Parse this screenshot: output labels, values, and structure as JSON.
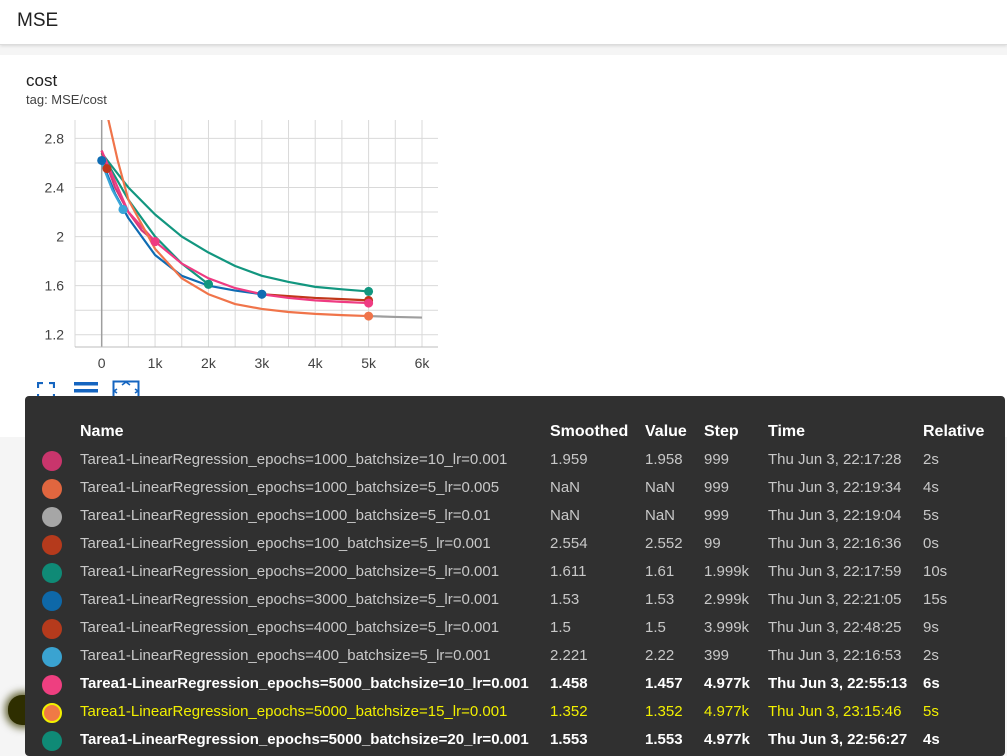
{
  "header": {
    "title": "MSE"
  },
  "card": {
    "title": "cost",
    "tag": "tag: MSE/cost"
  },
  "chart_data": {
    "type": "line",
    "title": "cost",
    "xlabel": "",
    "ylabel": "",
    "xlim": [
      -500,
      6300
    ],
    "ylim": [
      1.1,
      2.95
    ],
    "xticks": [
      0,
      1000,
      2000,
      3000,
      4000,
      5000,
      6000
    ],
    "xtick_labels": [
      "0",
      "1k",
      "2k",
      "3k",
      "4k",
      "5k",
      "6k"
    ],
    "yticks": [
      1.2,
      1.6,
      2.0,
      2.4,
      2.8
    ],
    "ytick_labels": [
      "1.2",
      "1.6",
      "2",
      "2.4",
      "2.8"
    ],
    "grid": true,
    "series": [
      {
        "name": "Tarea1-LinearRegression_epochs=1000_batchsize=5_lr=0.01",
        "color": "#9e9e9e",
        "x": [
          5000,
          5500,
          6000
        ],
        "y": [
          1.352,
          1.345,
          1.34
        ],
        "marker": false
      },
      {
        "name": "Tarea1-LinearRegression_epochs=2000_batchsize=5_lr=0.001",
        "color": "#12967f",
        "x": [
          0,
          500,
          1000,
          1500,
          2000
        ],
        "y": [
          2.68,
          2.3,
          2.0,
          1.78,
          1.611
        ],
        "marker": true
      },
      {
        "name": "Tarea1-LinearRegression_epochs=5000_batchsize=20_lr=0.001",
        "color": "#12967f",
        "x": [
          0,
          500,
          1000,
          1500,
          2000,
          2500,
          3000,
          3500,
          4000,
          4500,
          5000
        ],
        "y": [
          2.68,
          2.4,
          2.18,
          2.0,
          1.87,
          1.76,
          1.68,
          1.63,
          1.59,
          1.57,
          1.553
        ],
        "marker": true
      },
      {
        "name": "Tarea1-LinearRegression_epochs=3000_batchsize=5_lr=0.001",
        "color": "#0f6cb3",
        "x": [
          0,
          250,
          500,
          1000,
          1500,
          2000,
          2500,
          3000
        ],
        "y": [
          2.62,
          2.35,
          2.15,
          1.85,
          1.68,
          1.6,
          1.56,
          1.53
        ],
        "marker": true
      },
      {
        "name": "Tarea1-LinearRegression_epochs=400_batchsize=5_lr=0.001",
        "color": "#3aa6d9",
        "x": [
          0,
          200,
          400
        ],
        "y": [
          2.6,
          2.38,
          2.221
        ],
        "marker": true
      },
      {
        "name": "Tarea1-LinearRegression_epochs=4000_batchsize=5_lr=0.001",
        "color": "#c0371a",
        "x": [
          3000,
          3500,
          4000,
          4500,
          5000
        ],
        "y": [
          1.53,
          1.515,
          1.5,
          1.49,
          1.48
        ],
        "marker": true
      },
      {
        "name": "Tarea1-LinearRegression_epochs=100_batchsize=5_lr=0.001",
        "color": "#c0371a",
        "x": [
          0,
          99
        ],
        "y": [
          2.7,
          2.554
        ],
        "marker": true
      },
      {
        "name": "Tarea1-LinearRegression_epochs=1000_batchsize=10_lr=0.001",
        "color": "#d63a78",
        "x": [
          0,
          250,
          500,
          750,
          1000
        ],
        "y": [
          2.7,
          2.4,
          2.2,
          2.05,
          1.959
        ],
        "marker": true
      },
      {
        "name": "Tarea1-LinearRegression_epochs=5000_batchsize=10_lr=0.001",
        "color": "#ef3b82",
        "x": [
          0,
          500,
          1000,
          1500,
          2000,
          2500,
          3000,
          3500,
          4000,
          4500,
          5000
        ],
        "y": [
          2.7,
          2.2,
          1.96,
          1.78,
          1.66,
          1.58,
          1.53,
          1.5,
          1.48,
          1.468,
          1.458
        ],
        "marker": true
      },
      {
        "name": "Tarea1-LinearRegression_epochs=5000_batchsize=15_lr=0.001",
        "color": "#f0744a",
        "x": [
          100,
          300,
          500,
          1000,
          1500,
          2000,
          2500,
          3000,
          3500,
          4000,
          4500,
          5000
        ],
        "y": [
          3.0,
          2.62,
          2.3,
          1.9,
          1.66,
          1.53,
          1.45,
          1.41,
          1.385,
          1.37,
          1.36,
          1.352
        ],
        "marker": true
      }
    ]
  },
  "toolbar": {
    "icons": [
      "expand-icon",
      "list-icon",
      "fit-domain-icon"
    ]
  },
  "tooltip": {
    "headers": {
      "name": "Name",
      "smoothed": "Smoothed",
      "value": "Value",
      "step": "Step",
      "time": "Time",
      "relative": "Relative"
    },
    "rows": [
      {
        "color": "#c9356c",
        "name": "Tarea1-LinearRegression_epochs=1000_batchsize=10_lr=0.001",
        "smoothed": "1.959",
        "value": "1.958",
        "step": "999",
        "time": "Thu Jun 3, 22:17:28",
        "relative": "2s"
      },
      {
        "color": "#e0663f",
        "name": "Tarea1-LinearRegression_epochs=1000_batchsize=5_lr=0.005",
        "smoothed": "NaN",
        "value": "NaN",
        "step": "999",
        "time": "Thu Jun 3, 22:19:34",
        "relative": "4s"
      },
      {
        "color": "#a6a6a6",
        "name": "Tarea1-LinearRegression_epochs=1000_batchsize=5_lr=0.01",
        "smoothed": "NaN",
        "value": "NaN",
        "step": "999",
        "time": "Thu Jun 3, 22:19:04",
        "relative": "5s"
      },
      {
        "color": "#b53a1c",
        "name": "Tarea1-LinearRegression_epochs=100_batchsize=5_lr=0.001",
        "smoothed": "2.554",
        "value": "2.552",
        "step": "99",
        "time": "Thu Jun 3, 22:16:36",
        "relative": "0s"
      },
      {
        "color": "#0f8a76",
        "name": "Tarea1-LinearRegression_epochs=2000_batchsize=5_lr=0.001",
        "smoothed": "1.611",
        "value": "1.61",
        "step": "1.999k",
        "time": "Thu Jun 3, 22:17:59",
        "relative": "10s"
      },
      {
        "color": "#0e68a8",
        "name": "Tarea1-LinearRegression_epochs=3000_batchsize=5_lr=0.001",
        "smoothed": "1.53",
        "value": "1.53",
        "step": "2.999k",
        "time": "Thu Jun 3, 22:21:05",
        "relative": "15s"
      },
      {
        "color": "#b53a1c",
        "name": "Tarea1-LinearRegression_epochs=4000_batchsize=5_lr=0.001",
        "smoothed": "1.5",
        "value": "1.5",
        "step": "3.999k",
        "time": "Thu Jun 3, 22:48:25",
        "relative": "9s"
      },
      {
        "color": "#3aa3d1",
        "name": "Tarea1-LinearRegression_epochs=400_batchsize=5_lr=0.001",
        "smoothed": "2.221",
        "value": "2.22",
        "step": "399",
        "time": "Thu Jun 3, 22:16:53",
        "relative": "2s"
      },
      {
        "color": "#ee3f80",
        "name": "Tarea1-LinearRegression_epochs=5000_batchsize=10_lr=0.001",
        "smoothed": "1.458",
        "value": "1.457",
        "step": "4.977k",
        "time": "Thu Jun 3, 22:55:13",
        "relative": "6s",
        "style": "bold"
      },
      {
        "color": "#f07a45",
        "name": "Tarea1-LinearRegression_epochs=5000_batchsize=15_lr=0.001",
        "smoothed": "1.352",
        "value": "1.352",
        "step": "4.977k",
        "time": "Thu Jun 3, 23:15:46",
        "relative": "5s",
        "style": "hl"
      },
      {
        "color": "#0f8a76",
        "name": "Tarea1-LinearRegression_epochs=5000_batchsize=20_lr=0.001",
        "smoothed": "1.553",
        "value": "1.553",
        "step": "4.977k",
        "time": "Thu Jun 3, 22:56:27",
        "relative": "4s",
        "style": "bold"
      }
    ]
  }
}
